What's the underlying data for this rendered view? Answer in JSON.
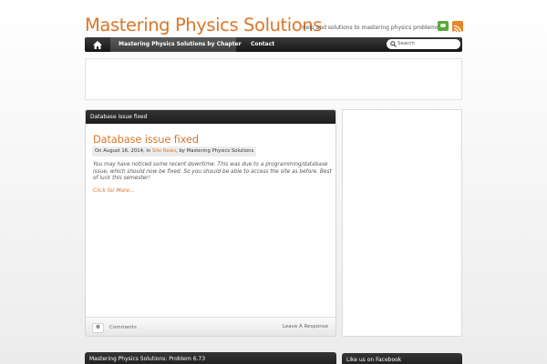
{
  "header": {
    "site_title": "Mastering Physics Solutions",
    "tagline": "Help and solutions to mastering physics problems.",
    "icons": [
      "chat-icon",
      "rss-icon"
    ]
  },
  "nav": {
    "home_icon": "home-icon",
    "items": [
      {
        "label": "Mastering Physics Solutions by Chapter",
        "active": true
      },
      {
        "label": "Contact",
        "active": false
      }
    ],
    "search_placeholder": "Search"
  },
  "post": {
    "header": "Database issue fixed",
    "title": "Database issue fixed",
    "meta": {
      "prefix": "On August 16, 2014, in ",
      "category": "Site News",
      "suffix": ", by Mastering Physics Solutions"
    },
    "excerpt": "You may have noticed some recent downtime. This was due to a programming/database issue, which should now be fixed. So you should be able to access the site as before. Best of luck this semester!",
    "read_more": "Click for More...",
    "comment_count": "0",
    "comments_label": "Comments",
    "leave_response": "Leave A Response"
  },
  "next_post": {
    "header": "Mastering Physics Solutions: Problem 6.73"
  },
  "sidebar": {
    "facebook_header": "Like us on Facebook"
  },
  "colors": {
    "accent": "#d9772a",
    "nav_bg": "#1f1f1f",
    "rss": "#e9852b",
    "chat": "#5aa83b"
  }
}
